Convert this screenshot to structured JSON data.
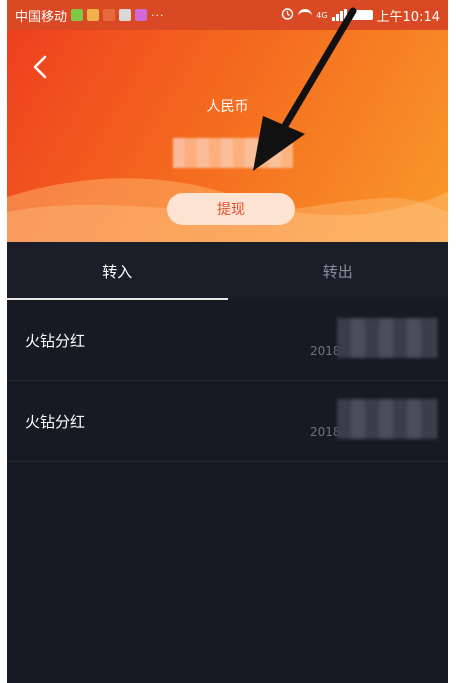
{
  "status_bar": {
    "carrier": "中国移动",
    "more": "···",
    "time": "上午10:14",
    "network": "4G",
    "app_icon_colors": [
      "#7ec845",
      "#f0b24a",
      "#e86a3a",
      "#d9d9d9",
      "#d06ad8"
    ]
  },
  "header": {
    "back_icon": "chevron-left-icon",
    "title": "人民币",
    "withdraw_label": "提现"
  },
  "tabs": [
    {
      "label": "转入",
      "active": true
    },
    {
      "label": "转出",
      "active": false
    }
  ],
  "records": [
    {
      "label": "火钻分红",
      "date": "2018"
    },
    {
      "label": "火钻分红",
      "date": "2018"
    }
  ],
  "colors": {
    "header_start": "#ee3f1f",
    "header_end": "#f99a2a",
    "background": "#171923",
    "button_bg": "#fde4d2",
    "button_text": "#e1502e"
  }
}
